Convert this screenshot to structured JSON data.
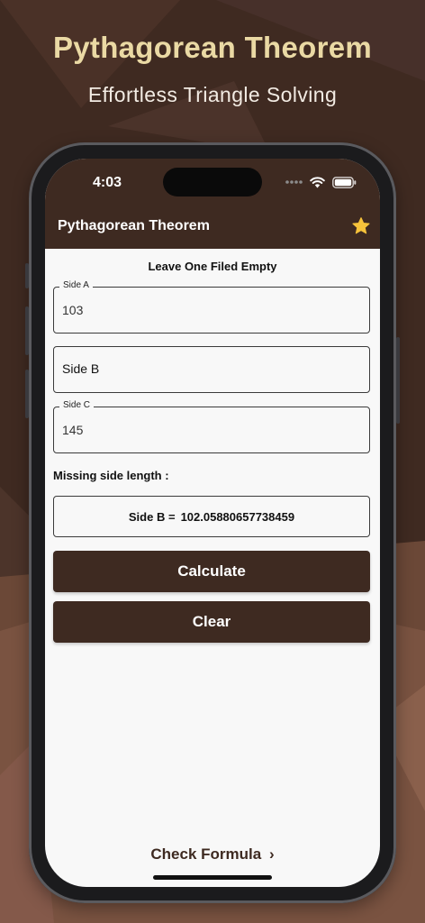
{
  "promo": {
    "title": "Pythagorean Theorem",
    "subtitle": "Effortless Triangle Solving"
  },
  "status_bar": {
    "time": "4:03",
    "icons": [
      "cellular-dots-icon",
      "wifi-icon",
      "battery-icon"
    ]
  },
  "app_bar": {
    "title": "Pythagorean Theorem",
    "action_icon": "star-icon"
  },
  "form": {
    "header": "Leave One Filed Empty",
    "side_a": {
      "label": "Side A",
      "value": "103"
    },
    "side_b": {
      "placeholder": "Side B"
    },
    "side_c": {
      "label": "Side C",
      "value": "145"
    }
  },
  "result": {
    "label": "Missing side length :",
    "name": "Side B =",
    "value": "102.05880657738459"
  },
  "buttons": {
    "calculate": "Calculate",
    "clear": "Clear"
  },
  "footer": {
    "check_formula": "Check Formula",
    "chevron": "›"
  },
  "colors": {
    "brand_brown": "#3e2a21",
    "title_gold": "#ead9a4",
    "star_yellow": "#f7c33b",
    "screen_bg": "#f8f8f8"
  }
}
